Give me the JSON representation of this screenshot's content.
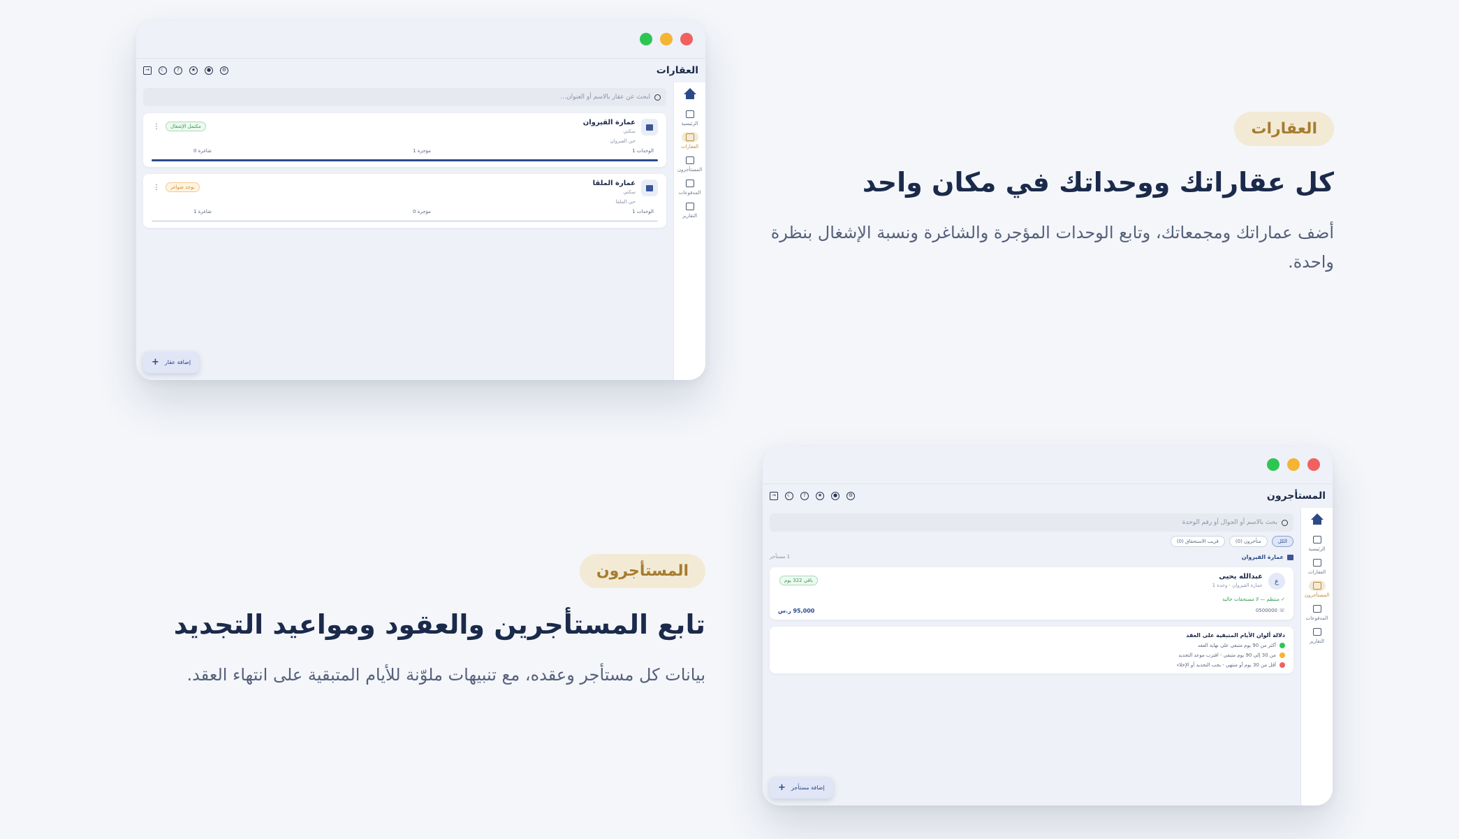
{
  "colors": {
    "accent": "#2c4a8a",
    "pill_bg": "#f3ead6",
    "pill_text": "#a67c2e",
    "green": "#2dc653",
    "orange": "#f5b431",
    "red": "#f26060"
  },
  "features": [
    {
      "pill": "العقارات",
      "heading": "كل عقاراتك ووحداتك في مكان واحد",
      "description": "أضف عماراتك ومجمعاتك، وتابع الوحدات المؤجرة والشاغرة ونسبة الإشغال بنظرة واحدة."
    },
    {
      "pill": "المستأجرون",
      "heading": "تابع المستأجرين والعقود ومواعيد التجديد",
      "description": "بيانات كل مستأجر وعقده، مع تنبيهات ملوّنة للأيام المتبقية على انتهاء العقد."
    }
  ],
  "nav": {
    "home": "الرئيسية",
    "properties": "العقارات",
    "tenants": "المستأجرون",
    "payments": "المدفوعات",
    "reports": "التقارير"
  },
  "window1": {
    "title": "العقارات",
    "search_placeholder": "ابحث عن عقار بالاسم أو العنوان...",
    "cards": [
      {
        "name": "عمارة القيروان",
        "type": "سكني",
        "location": "حي القيروان",
        "badge": "مكتمل الإشغال",
        "units": "الوحدات 1",
        "rented": "مؤجرة 1",
        "vacant": "شاغرة 0",
        "occupancy": 1.0
      },
      {
        "name": "عمارة الملقا",
        "type": "سكني",
        "location": "حي الملقا",
        "badge": "يوجد شواغر",
        "units": "الوحدات 1",
        "rented": "مؤجرة 0",
        "vacant": "شاغرة 1",
        "occupancy": 0.0
      }
    ],
    "add_button": "إضافة عقار"
  },
  "window2": {
    "title": "المستأجرون",
    "search_placeholder": "بحث بالاسم أو الجوال أو رقم الوحدة",
    "filters": [
      "الكل",
      "متأخرون (0)",
      "قريب الاستحقاق (0)"
    ],
    "group_title": "عمارة القيروان",
    "group_count": "1 مستأجر",
    "tenant": {
      "initial": "ع",
      "name": "عبدالله يحيى",
      "unit": "عمارة القيروان - وحدة 1",
      "days_badge": "باقي 322 يوم",
      "status": "منتظم — لا مستحقات حالية",
      "phone": "0500000",
      "amount": "95,000 ر.س"
    },
    "legend": {
      "title": "دلالة ألوان الأيام المتبقية على العقد",
      "items": [
        "أكثر من 90 يوم متبقي على نهاية العقد",
        "من 30 إلى 90 يوم متبقي - اقترب موعد التجديد",
        "أقل من 30 يوم أو منتهي - يجب التجديد أو الإخلاء"
      ]
    },
    "add_button": "إضافة مستأجر"
  }
}
